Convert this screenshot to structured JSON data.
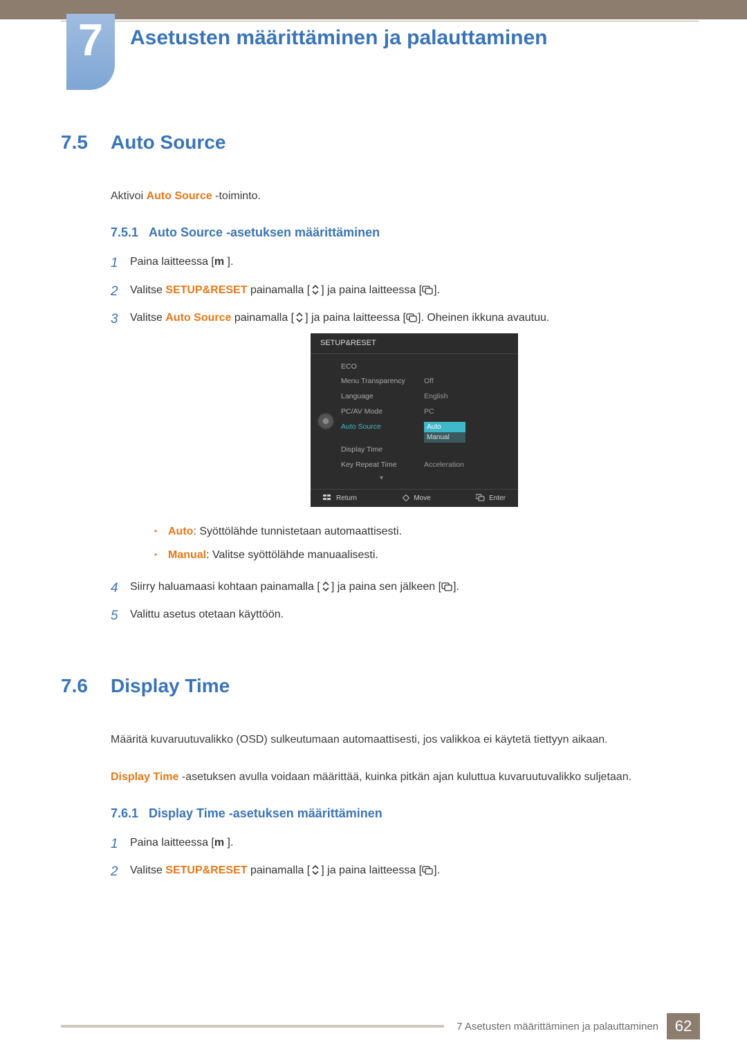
{
  "chapter": {
    "number": "7",
    "title": "Asetusten määrittäminen ja palauttaminen"
  },
  "section75": {
    "num": "7.5",
    "title": "Auto Source",
    "intro_pre": "Aktivoi ",
    "intro_hl": "Auto Source",
    "intro_post": " -toiminto.",
    "sub_num": "7.5.1",
    "sub_title": "Auto Source -asetuksen määrittäminen",
    "step1_num": "1",
    "step1_pre": "Paina laitteessa [",
    "step1_sym": "m",
    "step1_post": "].",
    "step2_num": "2",
    "step2_pre": "Valitse ",
    "step2_hl": "SETUP&RESET",
    "step2_mid": " painamalla [",
    "step2_post": "] ja paina laitteessa [",
    "step2_end": "].",
    "step3_num": "3",
    "step3_pre": "Valitse ",
    "step3_hl": "Auto Source",
    "step3_mid": " painamalla [",
    "step3_post": "] ja paina laitteessa [",
    "step3_end": "]. Oheinen ikkuna avautuu.",
    "bullet1_hl": "Auto",
    "bullet1_text": ": Syöttölähde tunnistetaan automaattisesti.",
    "bullet2_hl": "Manual",
    "bullet2_text": ": Valitse syöttölähde manuaalisesti.",
    "step4_num": "4",
    "step4_pre": "Siirry haluamaasi kohtaan painamalla [",
    "step4_mid": "] ja paina sen jälkeen [",
    "step4_end": "].",
    "step5_num": "5",
    "step5_text": "Valittu asetus otetaan käyttöön."
  },
  "osd": {
    "header": "SETUP&RESET",
    "rows": [
      {
        "label": "ECO",
        "value": ""
      },
      {
        "label": "Menu Transparency",
        "value": "Off"
      },
      {
        "label": "Language",
        "value": "English"
      },
      {
        "label": "PC/AV Mode",
        "value": "PC"
      },
      {
        "label": "Auto Source",
        "value": "Auto"
      },
      {
        "label": "Display Time",
        "value": ""
      },
      {
        "label": "Key Repeat Time",
        "value": "Acceleration"
      }
    ],
    "secondary_value": "Manual",
    "footer_return": "Return",
    "footer_move": "Move",
    "footer_enter": "Enter"
  },
  "section76": {
    "num": "7.6",
    "title": "Display Time",
    "intro": "Määritä kuvaruutuvalikko (OSD) sulkeutumaan automaattisesti, jos valikkoa ei käytetä tiettyyn aikaan.",
    "para2_hl": "Display Time",
    "para2_text": " -asetuksen avulla voidaan määrittää, kuinka pitkän ajan kuluttua kuvaruutuvalikko suljetaan.",
    "sub_num": "7.6.1",
    "sub_title": "Display Time -asetuksen määrittäminen",
    "step1_num": "1",
    "step1_pre": "Paina laitteessa [",
    "step1_sym": "m",
    "step1_post": "].",
    "step2_num": "2",
    "step2_pre": "Valitse ",
    "step2_hl": "SETUP&RESET",
    "step2_mid": " painamalla [",
    "step2_post": "] ja paina laitteessa [",
    "step2_end": "]."
  },
  "footer": {
    "text": "7 Asetusten määrittäminen ja palauttaminen",
    "page": "62"
  }
}
